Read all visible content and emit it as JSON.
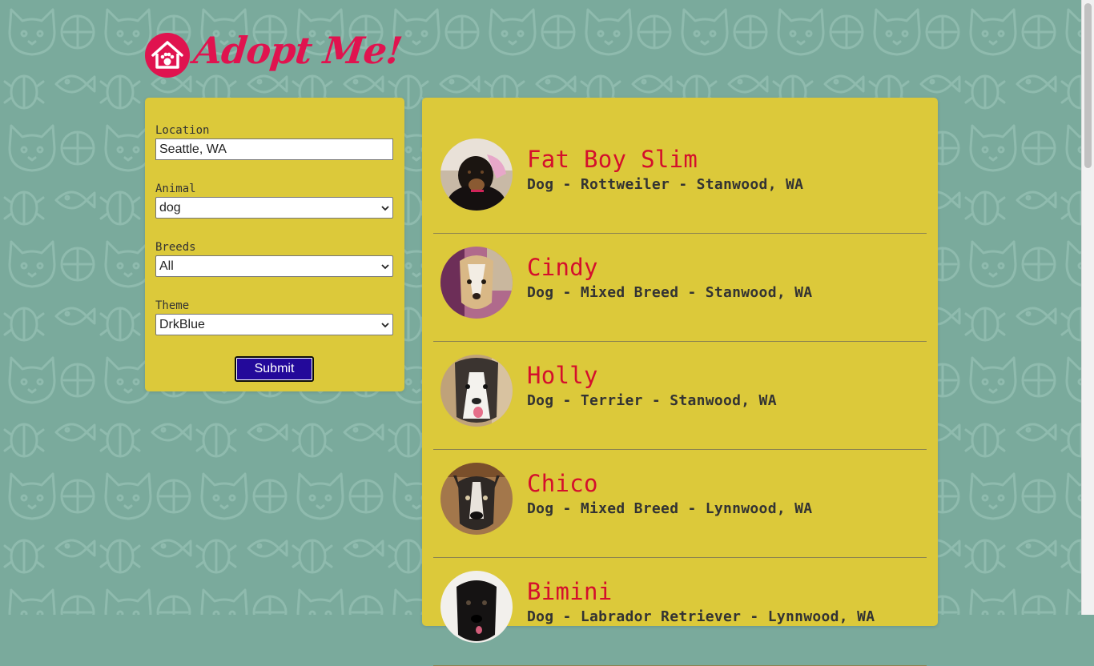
{
  "app": {
    "logo_text": "Adopt Me!",
    "brand_color": "#e0134f",
    "panel_color": "#dcc93a",
    "background_color": "#7aaa9c"
  },
  "search_form": {
    "location": {
      "label": "Location",
      "value": "Seattle, WA"
    },
    "animal": {
      "label": "Animal",
      "selected": "dog"
    },
    "breeds": {
      "label": "Breeds",
      "selected": "All"
    },
    "theme": {
      "label": "Theme",
      "selected": "DrkBlue"
    },
    "submit_label": "Submit",
    "submit_color": "#23099a"
  },
  "results": [
    {
      "name": "Fat Boy Slim",
      "info": "Dog - Rottweiler - Stanwood, WA"
    },
    {
      "name": "Cindy",
      "info": "Dog - Mixed Breed - Stanwood, WA"
    },
    {
      "name": "Holly",
      "info": "Dog - Terrier - Stanwood, WA"
    },
    {
      "name": "Chico",
      "info": "Dog - Mixed Breed - Lynnwood, WA"
    },
    {
      "name": "Bimini",
      "info": "Dog - Labrador Retriever - Lynnwood, WA"
    }
  ]
}
